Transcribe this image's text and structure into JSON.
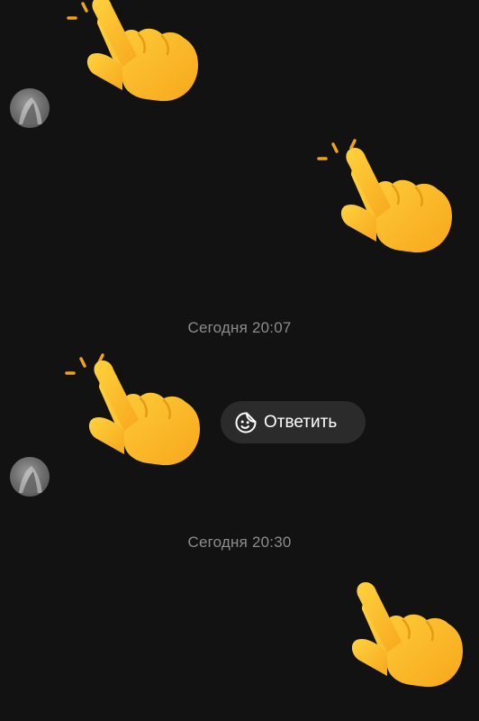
{
  "messages": [
    {
      "type": "emoji",
      "name": "pointing-hand-emoji",
      "side": "incoming"
    },
    {
      "type": "emoji",
      "name": "pointing-hand-emoji",
      "side": "outgoing"
    },
    {
      "type": "date",
      "text": "Сегодня 20:07"
    },
    {
      "type": "emoji",
      "name": "pointing-hand-emoji",
      "side": "incoming"
    },
    {
      "type": "date",
      "text": "Сегодня 20:30"
    },
    {
      "type": "emoji",
      "name": "pointing-hand-emoji",
      "side": "outgoing"
    }
  ],
  "separators": {
    "first": "Сегодня 20:07",
    "second": "Сегодня 20:30"
  },
  "reply": {
    "label": "Ответить",
    "icon": "sticker-smile-icon"
  },
  "colors": {
    "background": "#121212",
    "bubble": "#2b2b2b",
    "muted_text": "#8c8c8c",
    "emoji_yellow": "#ffc83d"
  }
}
